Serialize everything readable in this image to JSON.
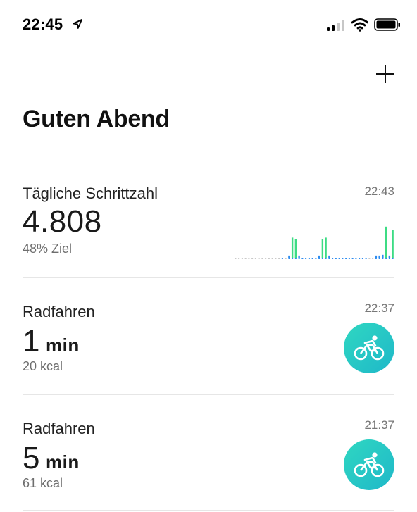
{
  "status_bar": {
    "time": "22:45"
  },
  "header": {
    "add_icon": "plus-icon",
    "title": "Guten Abend"
  },
  "cards": [
    {
      "title": "Tägliche Schrittzahl",
      "time": "22:43",
      "value": "4.808",
      "subtitle": "48% Ziel"
    },
    {
      "title": "Radfahren",
      "time": "22:37",
      "value": "1",
      "unit": "min",
      "subtitle": "20 kcal",
      "icon": "bicycle-icon"
    },
    {
      "title": "Radfahren",
      "time": "21:37",
      "value": "5",
      "unit": "min",
      "subtitle": "61 kcal",
      "icon": "bicycle-icon"
    }
  ],
  "colors": {
    "accent_green": "#3ddc84",
    "accent_blue": "#2d8cf0",
    "cycling_teal": "#22c6bd",
    "baseline_gray": "#c8c8c8"
  },
  "steps_sparkline": {
    "type": "bar",
    "slots": 48,
    "values": [
      0,
      0,
      0,
      0,
      0,
      0,
      0,
      0,
      0,
      0,
      0,
      0,
      0,
      0,
      0.04,
      0,
      0.06,
      0.55,
      0.5,
      0.06,
      0.05,
      0.05,
      0.05,
      0.05,
      0.05,
      0.06,
      0.5,
      0.55,
      0.06,
      0.05,
      0.05,
      0.05,
      0.05,
      0.05,
      0.05,
      0.05,
      0.05,
      0.05,
      0.05,
      0.05,
      0,
      0,
      0.06,
      0.06,
      0.08,
      0.85,
      0.06,
      0.75
    ],
    "green_threshold": 0.3
  }
}
